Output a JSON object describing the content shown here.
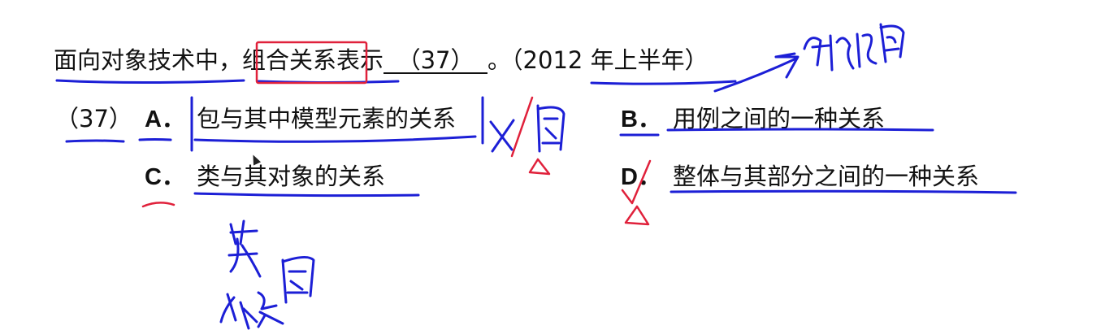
{
  "question": {
    "prefix": "面向对象技术中，",
    "highlight": "组合关系",
    "suffix": "表示",
    "blank": "（37）",
    "end": "。（2012 年上半年）"
  },
  "question_number": "（37）",
  "options": [
    {
      "letter": "A．",
      "text": "包与其中模型元素的关系"
    },
    {
      "letter": "B．",
      "text": "用例之间的一种关系"
    },
    {
      "letter": "C．",
      "text": "类与其对象的关系"
    },
    {
      "letter": "D．",
      "text": "整体与其部分之间的一种关系"
    }
  ],
  "colors": {
    "blue_ink": "#1c1fd6",
    "red_ink": "#e0213b",
    "text": "#111111"
  }
}
